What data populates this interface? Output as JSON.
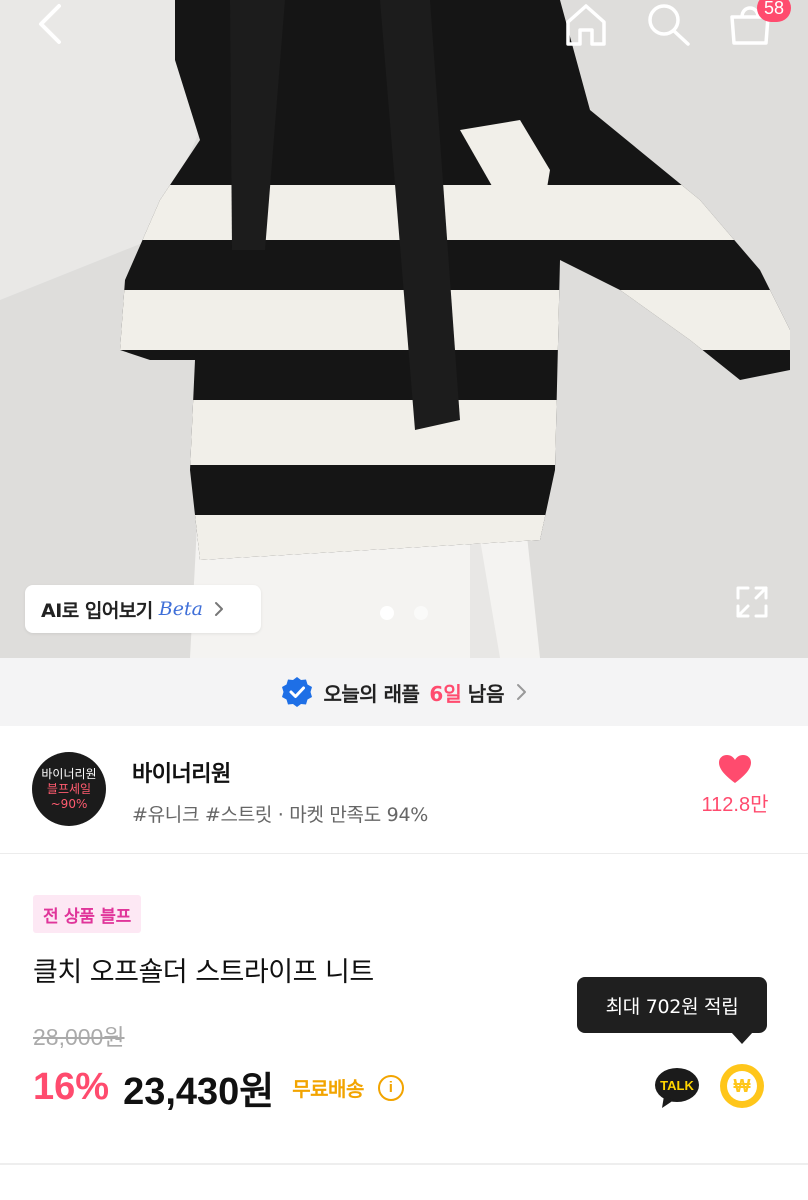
{
  "header": {
    "cart_count": "58"
  },
  "hero": {
    "ai_try_label": "AI로 입어보기",
    "ai_try_beta": "Beta",
    "image_count": 2,
    "active_image": 1
  },
  "raffle": {
    "label": "오늘의 래플",
    "days": "6일",
    "remaining": "남음"
  },
  "shop": {
    "logo_line1": "바이너리원",
    "logo_line2": "블프세일",
    "logo_line3": "~90%",
    "name": "바이너리원",
    "tags": "#유니크 #스트릿 · 마켓 만족도 94%",
    "like_count": "112.8만"
  },
  "product": {
    "badge": "전 상품 블프",
    "title": "클치 오프숄더 스트라이프 니트",
    "original_price": "28,000원",
    "discount": "16%",
    "price": "23,430원",
    "free_shipping": "무료배송",
    "info_mark": "i"
  },
  "reward": {
    "tooltip": "최대 702원 적립",
    "talk_label": "TALK",
    "coin_symbol": "₩"
  },
  "colors": {
    "accent": "#ff4b6e",
    "badge_text": "#e0359a",
    "badge_bg": "#fde8f4",
    "shipping": "#f2a400",
    "coin": "#ffc61a",
    "verified": "#1e6fe6"
  }
}
